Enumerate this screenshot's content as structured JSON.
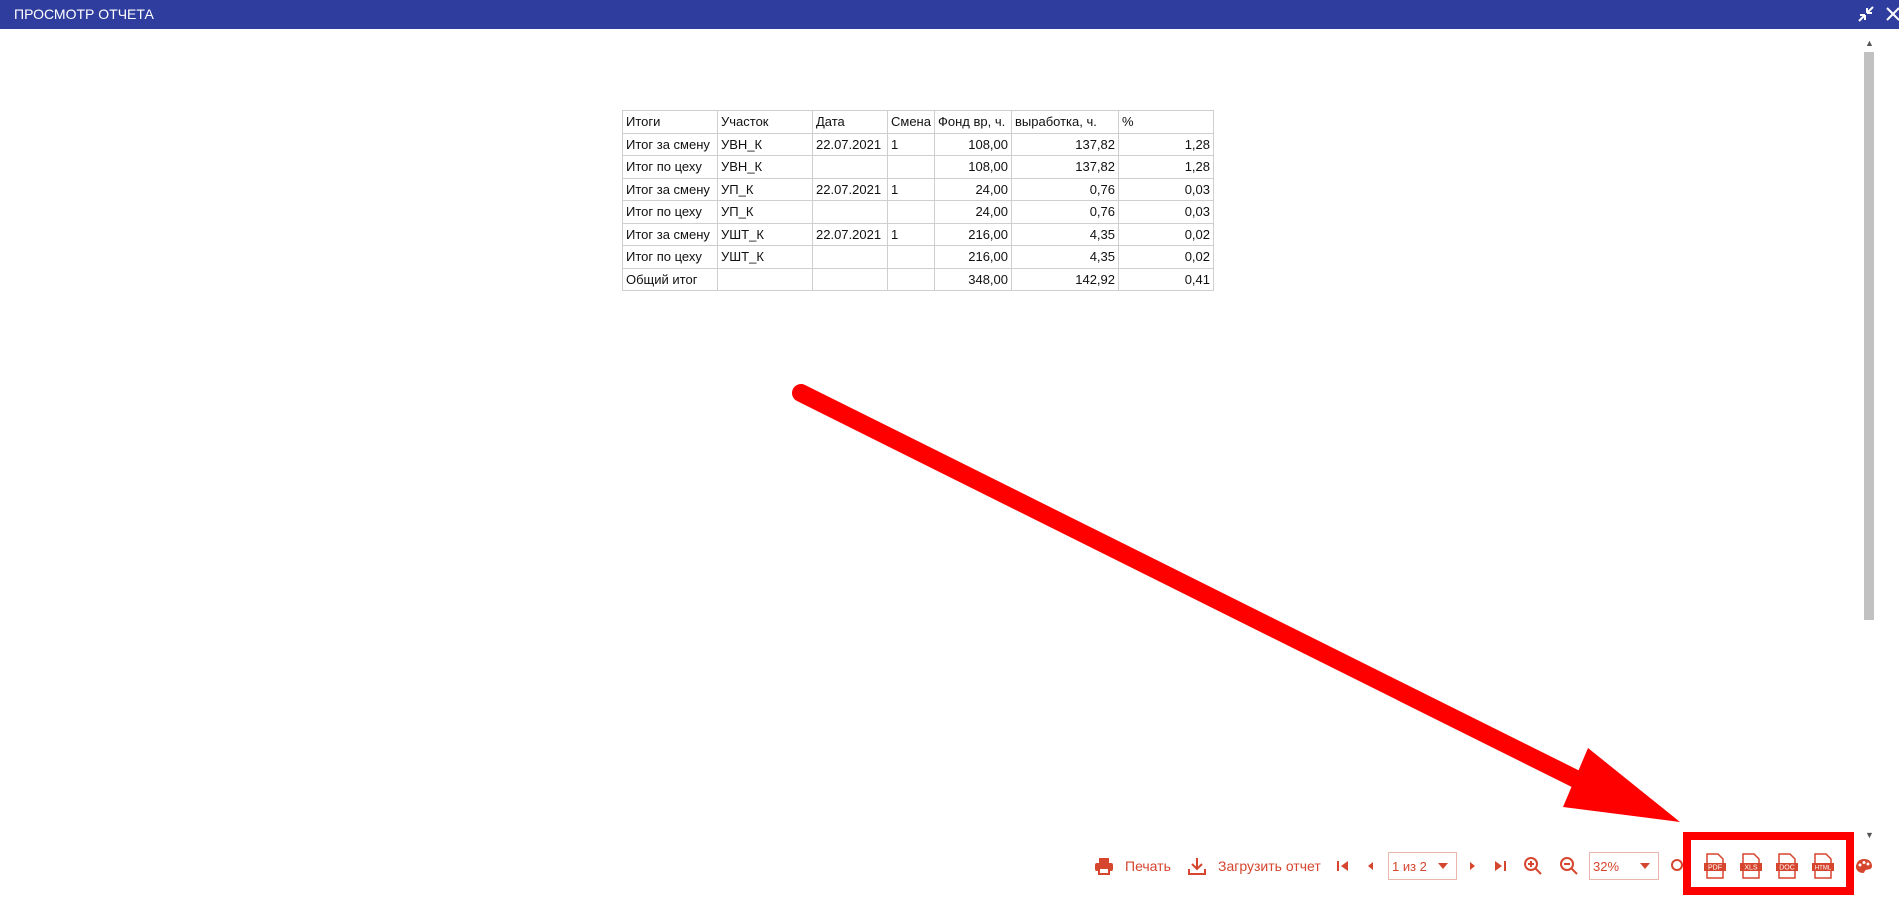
{
  "window": {
    "title": "ПРОСМОТР ОТЧЕТА"
  },
  "icons": {
    "minimize": "collapse-arrows-icon",
    "close": "close-icon",
    "print": "printer-icon",
    "download": "download-icon",
    "first": "first-page-icon",
    "prev": "prev-page-icon",
    "next": "next-page-icon",
    "last": "last-page-icon",
    "zoom_in": "zoom-in-icon",
    "zoom_out": "zoom-out-icon",
    "search": "search-icon",
    "pdf": "pdf-file-icon",
    "xls": "xls-file-icon",
    "doc": "doc-file-icon",
    "html": "html-file-icon",
    "theme": "palette-icon"
  },
  "report": {
    "headers": [
      "Итоги",
      "Участок",
      "Дата",
      "Смена",
      "Фонд вр, ч.",
      "выработка, ч.",
      "%"
    ],
    "rows": [
      [
        "Итог за смену",
        "УВН_К",
        "22.07.2021",
        "1",
        "108,00",
        "137,82",
        "1,28"
      ],
      [
        "Итог по цеху",
        "УВН_К",
        "",
        "",
        "108,00",
        "137,82",
        "1,28"
      ],
      [
        "Итог за смену",
        "УП_К",
        "22.07.2021",
        "1",
        "24,00",
        "0,76",
        "0,03"
      ],
      [
        "Итог по цеху",
        "УП_К",
        "",
        "",
        "24,00",
        "0,76",
        "0,03"
      ],
      [
        "Итог за смену",
        "УШТ_К",
        "22.07.2021",
        "1",
        "216,00",
        "4,35",
        "0,02"
      ],
      [
        "Итог по цеху",
        "УШТ_К",
        "",
        "",
        "216,00",
        "4,35",
        "0,02"
      ],
      [
        "Общий итог",
        "",
        "",
        "",
        "348,00",
        "142,92",
        "0,41"
      ]
    ]
  },
  "toolbar": {
    "print_label": "Печать",
    "download_label": "Загрузить отчет",
    "page_value": "1 из 2",
    "zoom_value": "32%",
    "formats": [
      "PDF",
      "XLS",
      "DOC",
      "HTML"
    ]
  },
  "colors": {
    "titlebar": "#2f3e9e",
    "accent": "#d6452e",
    "annotation": "#ff0000"
  }
}
